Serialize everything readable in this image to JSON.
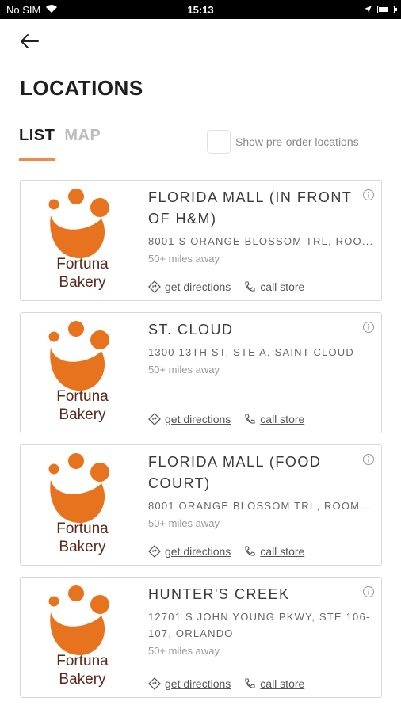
{
  "status_bar": {
    "carrier": "No SIM",
    "time": "15:13"
  },
  "page": {
    "title": "LOCATIONS"
  },
  "tabs": [
    {
      "label": "LIST"
    },
    {
      "label": "MAP"
    }
  ],
  "preorder": {
    "label": "Show pre-order locations",
    "checked": false
  },
  "brand": {
    "logo_text_line1": "Fortuna",
    "logo_text_line2": "Bakery",
    "accent": "#E8731E",
    "brown": "#5A2A1A"
  },
  "actions": {
    "directions": "get directions",
    "call": "call store"
  },
  "locations": [
    {
      "name": "FLORIDA MALL (IN FRONT OF H&M)",
      "address": "8001 S ORANGE BLOSSOM TRL, ROO...",
      "distance": "50+ miles away"
    },
    {
      "name": "ST. CLOUD",
      "address": "1300 13TH ST, STE A, SAINT CLOUD",
      "distance": "50+ miles away"
    },
    {
      "name": "FLORIDA MALL (FOOD COURT)",
      "address": "8001 ORANGE BLOSSOM TRL, ROOM...",
      "distance": "50+ miles away"
    },
    {
      "name": "HUNTER'S CREEK",
      "address": "12701 S JOHN YOUNG PKWY, STE 106-107, ORLANDO",
      "distance": "50+ miles away"
    }
  ]
}
